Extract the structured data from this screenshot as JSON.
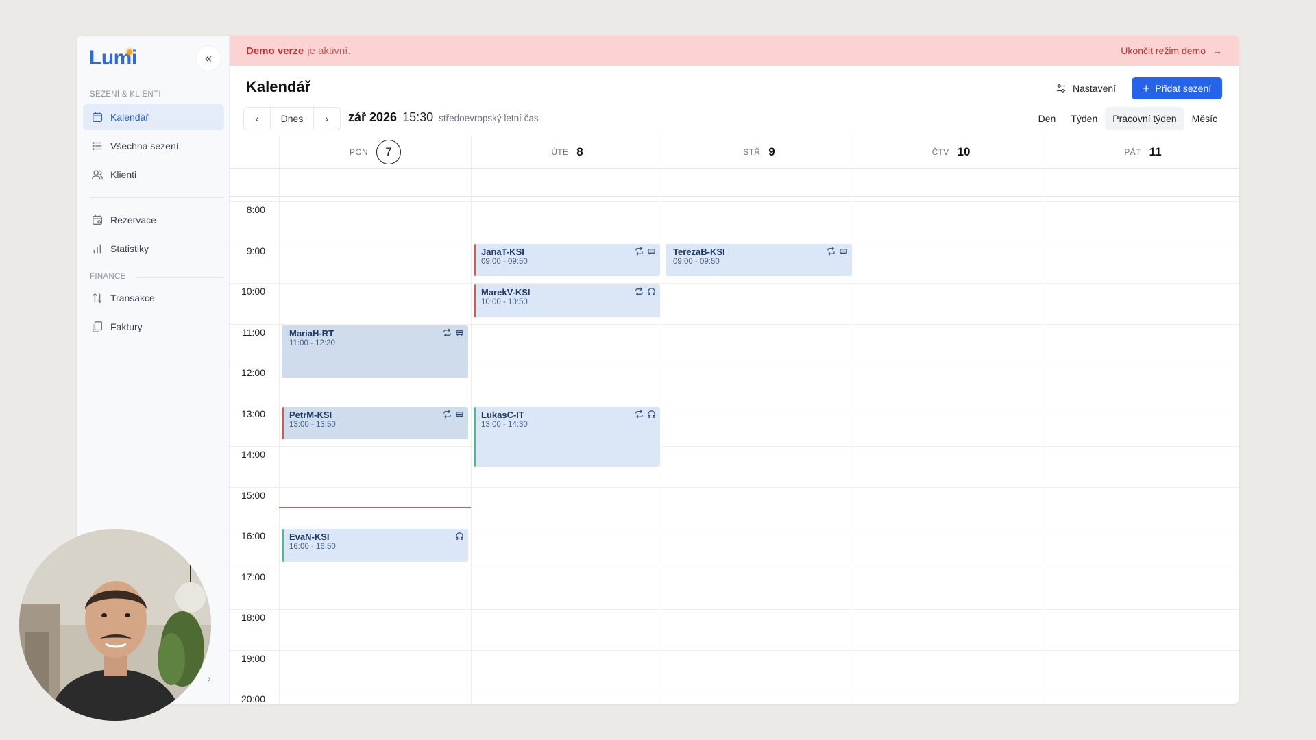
{
  "app": {
    "logo": "Lumi",
    "collapse_icon": "«",
    "expand_icon": "›"
  },
  "sidebar": {
    "sections": [
      {
        "label": "SEZENÍ & KLIENTI"
      },
      {
        "label": "FINANCE"
      }
    ],
    "items": [
      {
        "label": "Kalendář",
        "icon": "calendar-icon",
        "active": true
      },
      {
        "label": "Všechna sezení",
        "icon": "list-icon"
      },
      {
        "label": "Klienti",
        "icon": "users-icon"
      },
      {
        "label": "Rezervace",
        "icon": "calendar-check-icon"
      },
      {
        "label": "Statistiky",
        "icon": "bar-chart-icon"
      },
      {
        "label": "Transakce",
        "icon": "arrows-updown-icon"
      },
      {
        "label": "Faktury",
        "icon": "documents-icon"
      }
    ]
  },
  "banner": {
    "strong": "Demo verze",
    "text": "je aktivní.",
    "exit_label": "Ukončit režim demo",
    "exit_icon": "→"
  },
  "header": {
    "title": "Kalendář",
    "settings_label": "Nastavení",
    "add_label": "Přidat sezení",
    "add_icon": "+"
  },
  "toolbar": {
    "prev": "‹",
    "today": "Dnes",
    "next": "›",
    "month": "zář 2026",
    "time": "15:30",
    "timezone": "středoevropský letní čas",
    "views": [
      {
        "label": "Den"
      },
      {
        "label": "Týden"
      },
      {
        "label": "Pracovní týden",
        "active": true
      },
      {
        "label": "Měsíc"
      }
    ]
  },
  "days": [
    {
      "name": "PON",
      "num": "7",
      "today": true
    },
    {
      "name": "ÚTE",
      "num": "8"
    },
    {
      "name": "STŘ",
      "num": "9"
    },
    {
      "name": "ČTV",
      "num": "10"
    },
    {
      "name": "PÁT",
      "num": "11"
    }
  ],
  "hours": [
    "8:00",
    "9:00",
    "10:00",
    "11:00",
    "12:00",
    "13:00",
    "14:00",
    "15:00",
    "16:00",
    "17:00",
    "18:00",
    "19:00",
    "20:00"
  ],
  "now": {
    "day": 0,
    "hour": 15.5
  },
  "events": [
    {
      "day": 1,
      "name": "JanaT-KSI",
      "time": "09:00 - 09:50",
      "start": 9,
      "end": 9.833,
      "accent": "#e05252",
      "icons": [
        "repeat-icon",
        "in-person-icon"
      ]
    },
    {
      "day": 2,
      "name": "TerezaB-KSI",
      "time": "09:00 - 09:50",
      "start": 9,
      "end": 9.833,
      "accent": "",
      "icons": [
        "repeat-icon",
        "in-person-icon"
      ]
    },
    {
      "day": 1,
      "name": "MarekV-KSI",
      "time": "10:00 - 10:50",
      "start": 10,
      "end": 10.833,
      "accent": "#e05252",
      "icons": [
        "repeat-icon",
        "headset-icon"
      ]
    },
    {
      "day": 0,
      "name": "MariaH-RT",
      "time": "11:00 - 12:20",
      "start": 11,
      "end": 12.333,
      "accent": "",
      "past": true,
      "icons": [
        "repeat-icon",
        "in-person-icon"
      ]
    },
    {
      "day": 0,
      "name": "PetrM-KSI",
      "time": "13:00 - 13:50",
      "start": 13,
      "end": 13.833,
      "accent": "#e05252",
      "past": true,
      "icons": [
        "repeat-icon",
        "in-person-icon"
      ]
    },
    {
      "day": 1,
      "name": "LukasC-IT",
      "time": "13:00 - 14:30",
      "start": 13,
      "end": 14.5,
      "accent": "#3fbf8a",
      "icons": [
        "repeat-icon",
        "headset-icon"
      ]
    },
    {
      "day": 0,
      "name": "EvaN-KSI",
      "time": "16:00 - 16:50",
      "start": 16,
      "end": 16.833,
      "accent": "#3fbf8a",
      "icons": [
        "headset-icon"
      ]
    }
  ],
  "colors": {
    "accent": "#2563eb",
    "banner_bg": "#fbd3d3",
    "event_bg": "#dbe7f7",
    "now_line": "#e5554f"
  }
}
